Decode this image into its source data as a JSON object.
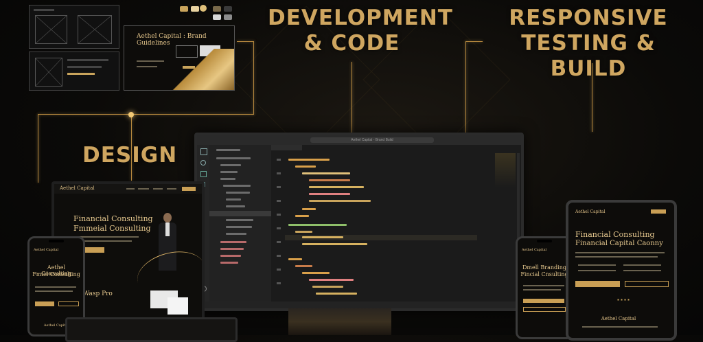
{
  "headings": {
    "dev_line1": "DEVELOPMENT",
    "dev_line2": "& CODE",
    "resp_line1": "RESPONSIVE",
    "resp_line2": "TESTING & BUILD",
    "design": "DESIGN"
  },
  "brand_guide": {
    "title": "Aethel Capital : Brand Guidelines"
  },
  "laptop": {
    "logo": "Aethel Capital",
    "headline1": "Financial Consulting",
    "headline2": "Fmmeial Consulting",
    "subhead": "Wasp Pro"
  },
  "phone_left": {
    "logo": "Aethel Capital",
    "headline1": "Aethel Consulting",
    "headline2": "Fmiel Consulting",
    "footer": "Aethel Capital"
  },
  "phone_right": {
    "logo": "Aethel Capital",
    "headline1": "Dmell Branding",
    "headline2": "Fincial Cnsulting"
  },
  "tablet": {
    "logo": "Aethel Capital",
    "headline1": "Financial Consulting",
    "headline2": "Financial Capital Caonny",
    "footer": "Aethel Capital"
  },
  "monitor": {
    "search_text": "Aethel Capital - Brand Build"
  },
  "colors": {
    "gold": "#cfa660",
    "accent_bright": "#f2c976",
    "bg": "#0b0a08",
    "swatches": [
      "#c9a45c",
      "#e8d3a1",
      "#7a6a4a",
      "#3a3a3a",
      "#d9d9d9",
      "#8c8c8c"
    ]
  }
}
